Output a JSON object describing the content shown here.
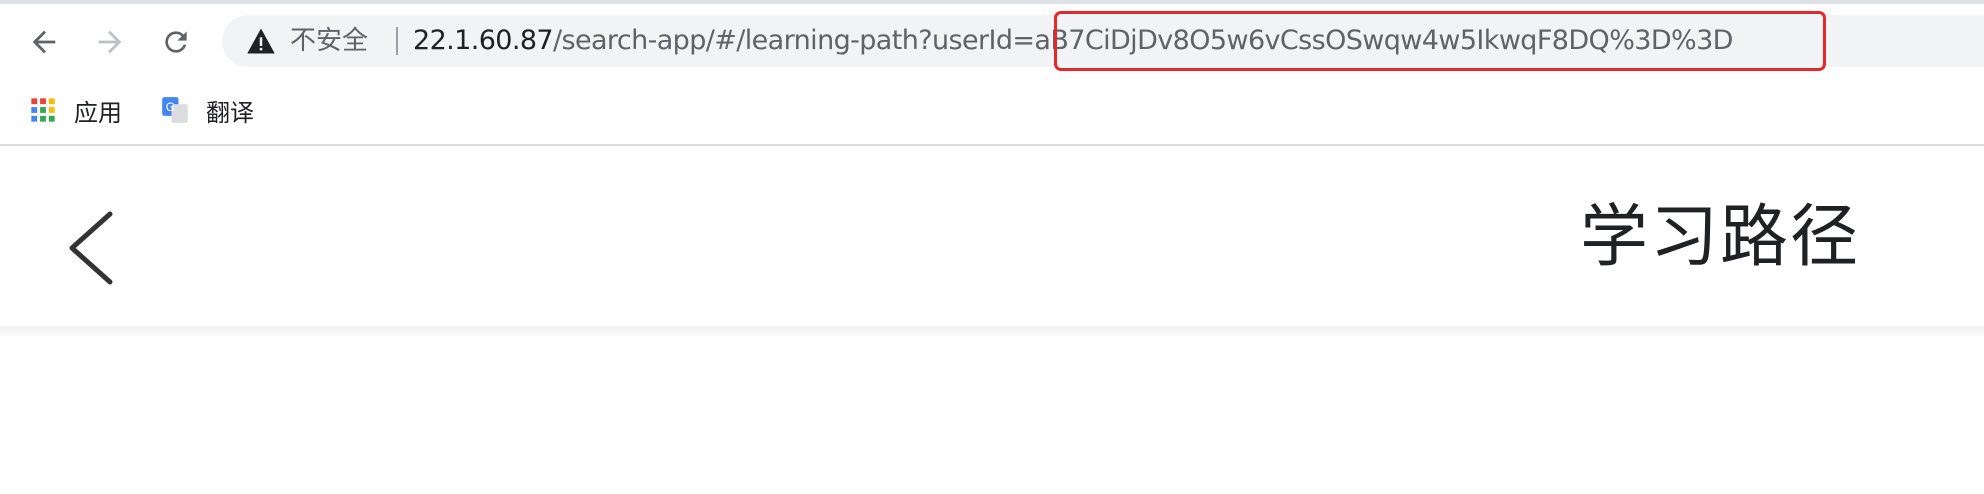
{
  "browser": {
    "security_label": "不安全",
    "url_host": "22.1.60.87",
    "url_path": "/search-app/#/learning-path?userId=",
    "url_query_value": "aB7CiDjDv8O5w6vCssOSwqw4w5IkwqF8DQ%3D%3D",
    "highlight_color": "#e8272b"
  },
  "bookmarks": [
    {
      "label": "应用",
      "icon": "apps-grid-icon"
    },
    {
      "label": "翻译",
      "icon": "translate-icon"
    }
  ],
  "page": {
    "title": "学习路径",
    "back_icon": "chevron-left-icon"
  }
}
